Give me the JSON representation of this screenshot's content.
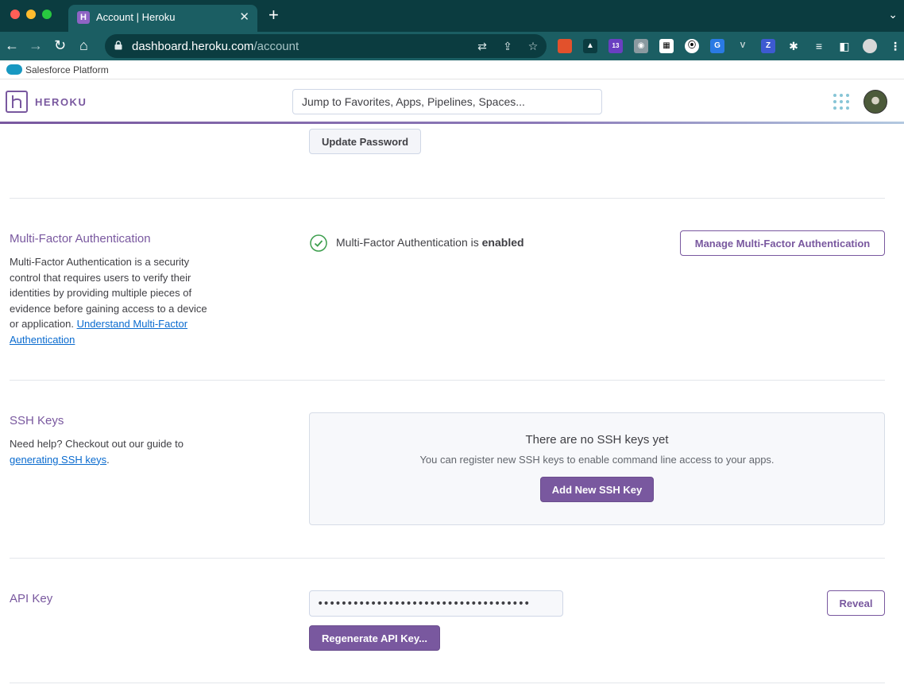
{
  "browser": {
    "tab_title": "Account | Heroku",
    "tab_favicon": "H",
    "url_domain": "dashboard.heroku.com",
    "url_path": "/account",
    "extension_badge": "13",
    "bookmark": "Salesforce Platform"
  },
  "header": {
    "logo_text": "HEROKU",
    "search_placeholder": "Jump to Favorites, Apps, Pipelines, Spaces..."
  },
  "password": {
    "update_button": "Update Password"
  },
  "mfa": {
    "title": "Multi-Factor Authentication",
    "description": "Multi-Factor Authentication is a security control that requires users to verify their identities by providing multiple pieces of evidence before gaining access to a device or application.",
    "link_text": "Understand Multi-Factor Authentication",
    "status_prefix": "Multi-Factor Authentication is",
    "status_value": "enabled",
    "manage_button": "Manage Multi-Factor Authentication"
  },
  "ssh": {
    "title": "SSH Keys",
    "help_text": "Need help? Checkout out our guide to",
    "link_text": "generating SSH keys",
    "empty_title": "There are no SSH keys yet",
    "empty_text": "You can register new SSH keys to enable command line access to your apps.",
    "add_button": "Add New SSH Key"
  },
  "api": {
    "title": "API Key",
    "masked_value": "••••••••••••••••••••••••••••••••••••",
    "reveal_button": "Reveal",
    "regenerate_button": "Regenerate API Key..."
  },
  "colors": {
    "heroku_purple": "#79589f",
    "chrome_tab_bar": "#0b3c40",
    "link_blue": "#0a6bcf",
    "success_green": "#3c9e4d"
  }
}
